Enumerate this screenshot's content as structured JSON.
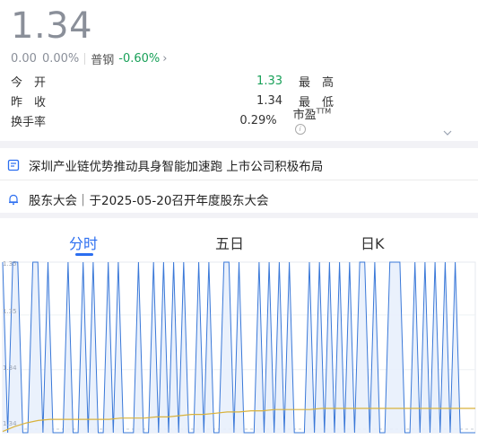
{
  "quote": {
    "price": "1.34",
    "change": "0.00",
    "change_pct": "0.00%",
    "reference_name": "普钢",
    "reference_change": "-0.60%"
  },
  "stats": {
    "open_label": "今　开",
    "open_value": "1.33",
    "high_label": "最　高",
    "prev_close_label": "昨　收",
    "prev_close_value": "1.34",
    "low_label": "最　低",
    "turnover_label": "换手率",
    "turnover_value": "0.29%",
    "pe_label": "市盈",
    "pe_sup": "TTM",
    "pe_info": "i"
  },
  "news": [
    {
      "icon": "document-icon",
      "text": "深圳产业链优势推动具身智能加速跑 上市公司积极布局"
    },
    {
      "icon": "bell-icon",
      "text": "股东大会｜于2025-05-20召开年度股东大会"
    }
  ],
  "tabs": [
    "分时",
    "五日",
    "日K"
  ],
  "active_tab": "分时",
  "colors": {
    "accent": "#2b6ef0",
    "down": "#18a058",
    "price_line": "#3a78d8",
    "avg_line": "#d8b23c",
    "fill": "#e8effc"
  },
  "chart_data": {
    "type": "line",
    "ytick_labels": [
      "1.35",
      "1.35",
      "1.34",
      "1.34"
    ],
    "ylim": [
      1.338,
      1.352
    ],
    "series": [
      {
        "values": [
          1.352,
          1.338,
          1.352,
          1.352,
          1.338,
          1.338,
          1.352,
          1.352,
          1.338,
          1.352,
          1.338,
          1.338,
          1.338,
          1.352,
          1.338,
          1.338,
          1.352,
          1.338,
          1.352,
          1.338,
          1.338,
          1.352,
          1.338,
          1.352,
          1.338,
          1.338,
          1.338,
          1.352,
          1.338,
          1.338,
          1.352,
          1.338,
          1.352,
          1.338,
          1.352,
          1.338,
          1.352,
          1.338,
          1.338,
          1.352,
          1.338,
          1.352,
          1.338,
          1.338,
          1.352,
          1.352,
          1.338,
          1.352,
          1.338,
          1.338,
          1.338,
          1.352,
          1.338,
          1.352,
          1.338,
          1.352,
          1.338,
          1.352,
          1.338,
          1.338,
          1.338,
          1.352,
          1.338,
          1.352,
          1.338,
          1.352,
          1.338,
          1.352,
          1.338,
          1.352,
          1.338,
          1.352,
          1.352,
          1.338,
          1.352,
          1.338,
          1.338,
          1.352,
          1.352,
          1.352,
          1.338,
          1.338,
          1.352,
          1.338,
          1.352,
          1.338,
          1.352,
          1.338,
          1.352,
          1.338,
          1.352,
          1.338,
          1.338,
          1.338,
          1.338
        ]
      },
      {
        "values": [
          1.3381,
          1.3385,
          1.3388,
          1.339,
          1.3391,
          1.3391,
          1.3391,
          1.3391,
          1.3391,
          1.3391,
          1.3392,
          1.3392,
          1.3392,
          1.3393,
          1.3393,
          1.3394,
          1.3395,
          1.3395,
          1.3396,
          1.3397,
          1.3397,
          1.3398,
          1.3398,
          1.3399,
          1.3399,
          1.3399,
          1.3399,
          1.34,
          1.34,
          1.34,
          1.34,
          1.34,
          1.34,
          1.34,
          1.34,
          1.34,
          1.34,
          1.34,
          1.34,
          1.34,
          1.34
        ]
      }
    ]
  }
}
